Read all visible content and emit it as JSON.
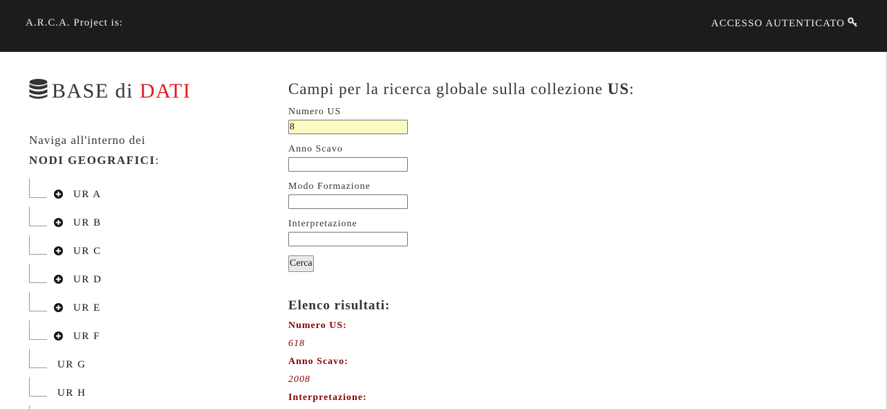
{
  "header": {
    "brand": "A.R.C.A. Project is:",
    "login_label": "ACCESSO AUTENTICATO"
  },
  "sidebar": {
    "title_prefix": "BASE di ",
    "title_highlight": "DATI",
    "intro_line": "Naviga all'interno dei",
    "intro_bold": "NODI GEOGRAFICI",
    "intro_suffix": ":",
    "tree": [
      {
        "label": "UR A",
        "expandable": true
      },
      {
        "label": "UR B",
        "expandable": true
      },
      {
        "label": "UR C",
        "expandable": true
      },
      {
        "label": "UR D",
        "expandable": true
      },
      {
        "label": "UR E",
        "expandable": true
      },
      {
        "label": "UR F",
        "expandable": true
      },
      {
        "label": "UR G",
        "expandable": false
      },
      {
        "label": "UR H",
        "expandable": false
      }
    ]
  },
  "search": {
    "title_prefix": "Campi per la ricerca globale sulla collezione ",
    "title_bold": "US",
    "title_suffix": ":",
    "fields": [
      {
        "label": "Numero US",
        "value": "8"
      },
      {
        "label": "Anno Scavo",
        "value": ""
      },
      {
        "label": "Modo Formazione",
        "value": ""
      },
      {
        "label": "Interpretazione",
        "value": ""
      }
    ],
    "button_label": "Cerca"
  },
  "results": {
    "title": "Elenco risultati:",
    "items": [
      {
        "key": "Numero US:",
        "value": "618"
      },
      {
        "key": "Anno Scavo:",
        "value": "2008"
      },
      {
        "key": "Interpretazione:",
        "value": ""
      }
    ]
  },
  "colors": {
    "topbar": "#1c1c1c",
    "highlight_red": "#e01b1b",
    "result_red": "#8b0000",
    "filled_input": "#fafcc4"
  }
}
